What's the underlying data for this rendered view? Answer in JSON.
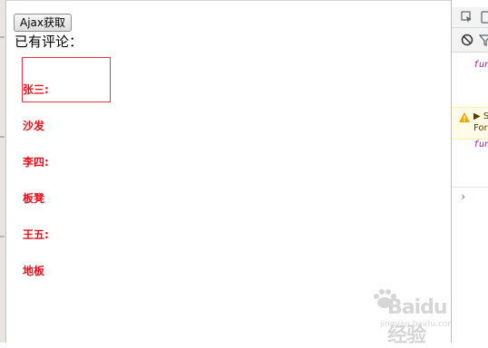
{
  "page": {
    "ajax_button_label": "Ajax获取",
    "comments_heading": "已有评论：",
    "comments": [
      {
        "text": "张三:"
      },
      {
        "text": "沙发"
      },
      {
        "text": "李四:"
      },
      {
        "text": "板凳"
      },
      {
        "text": "王五:"
      },
      {
        "text": "地板"
      }
    ]
  },
  "devtools": {
    "inspect_icon": "inspect-element-icon",
    "device_icon": "device-toolbar-icon",
    "clear_icon": "clear-console-icon",
    "filter_icon": "filter-icon",
    "log_1": "fun",
    "warning_icon": "warning-icon",
    "warning_line_1": "▶ S",
    "warning_line_2": "For",
    "log_2": "fun",
    "prompt": "›"
  },
  "watermark": {
    "brand": "Baidu经验",
    "url": "jingyan.baidu.com",
    "logo_icon": "paw-logo-icon"
  },
  "colors": {
    "comment_red": "#e8101a",
    "box_border": "#e8323a",
    "warning_bg": "#fffbe6",
    "function_purple": "#a01c9b",
    "prompt_blue": "#367cf1"
  }
}
